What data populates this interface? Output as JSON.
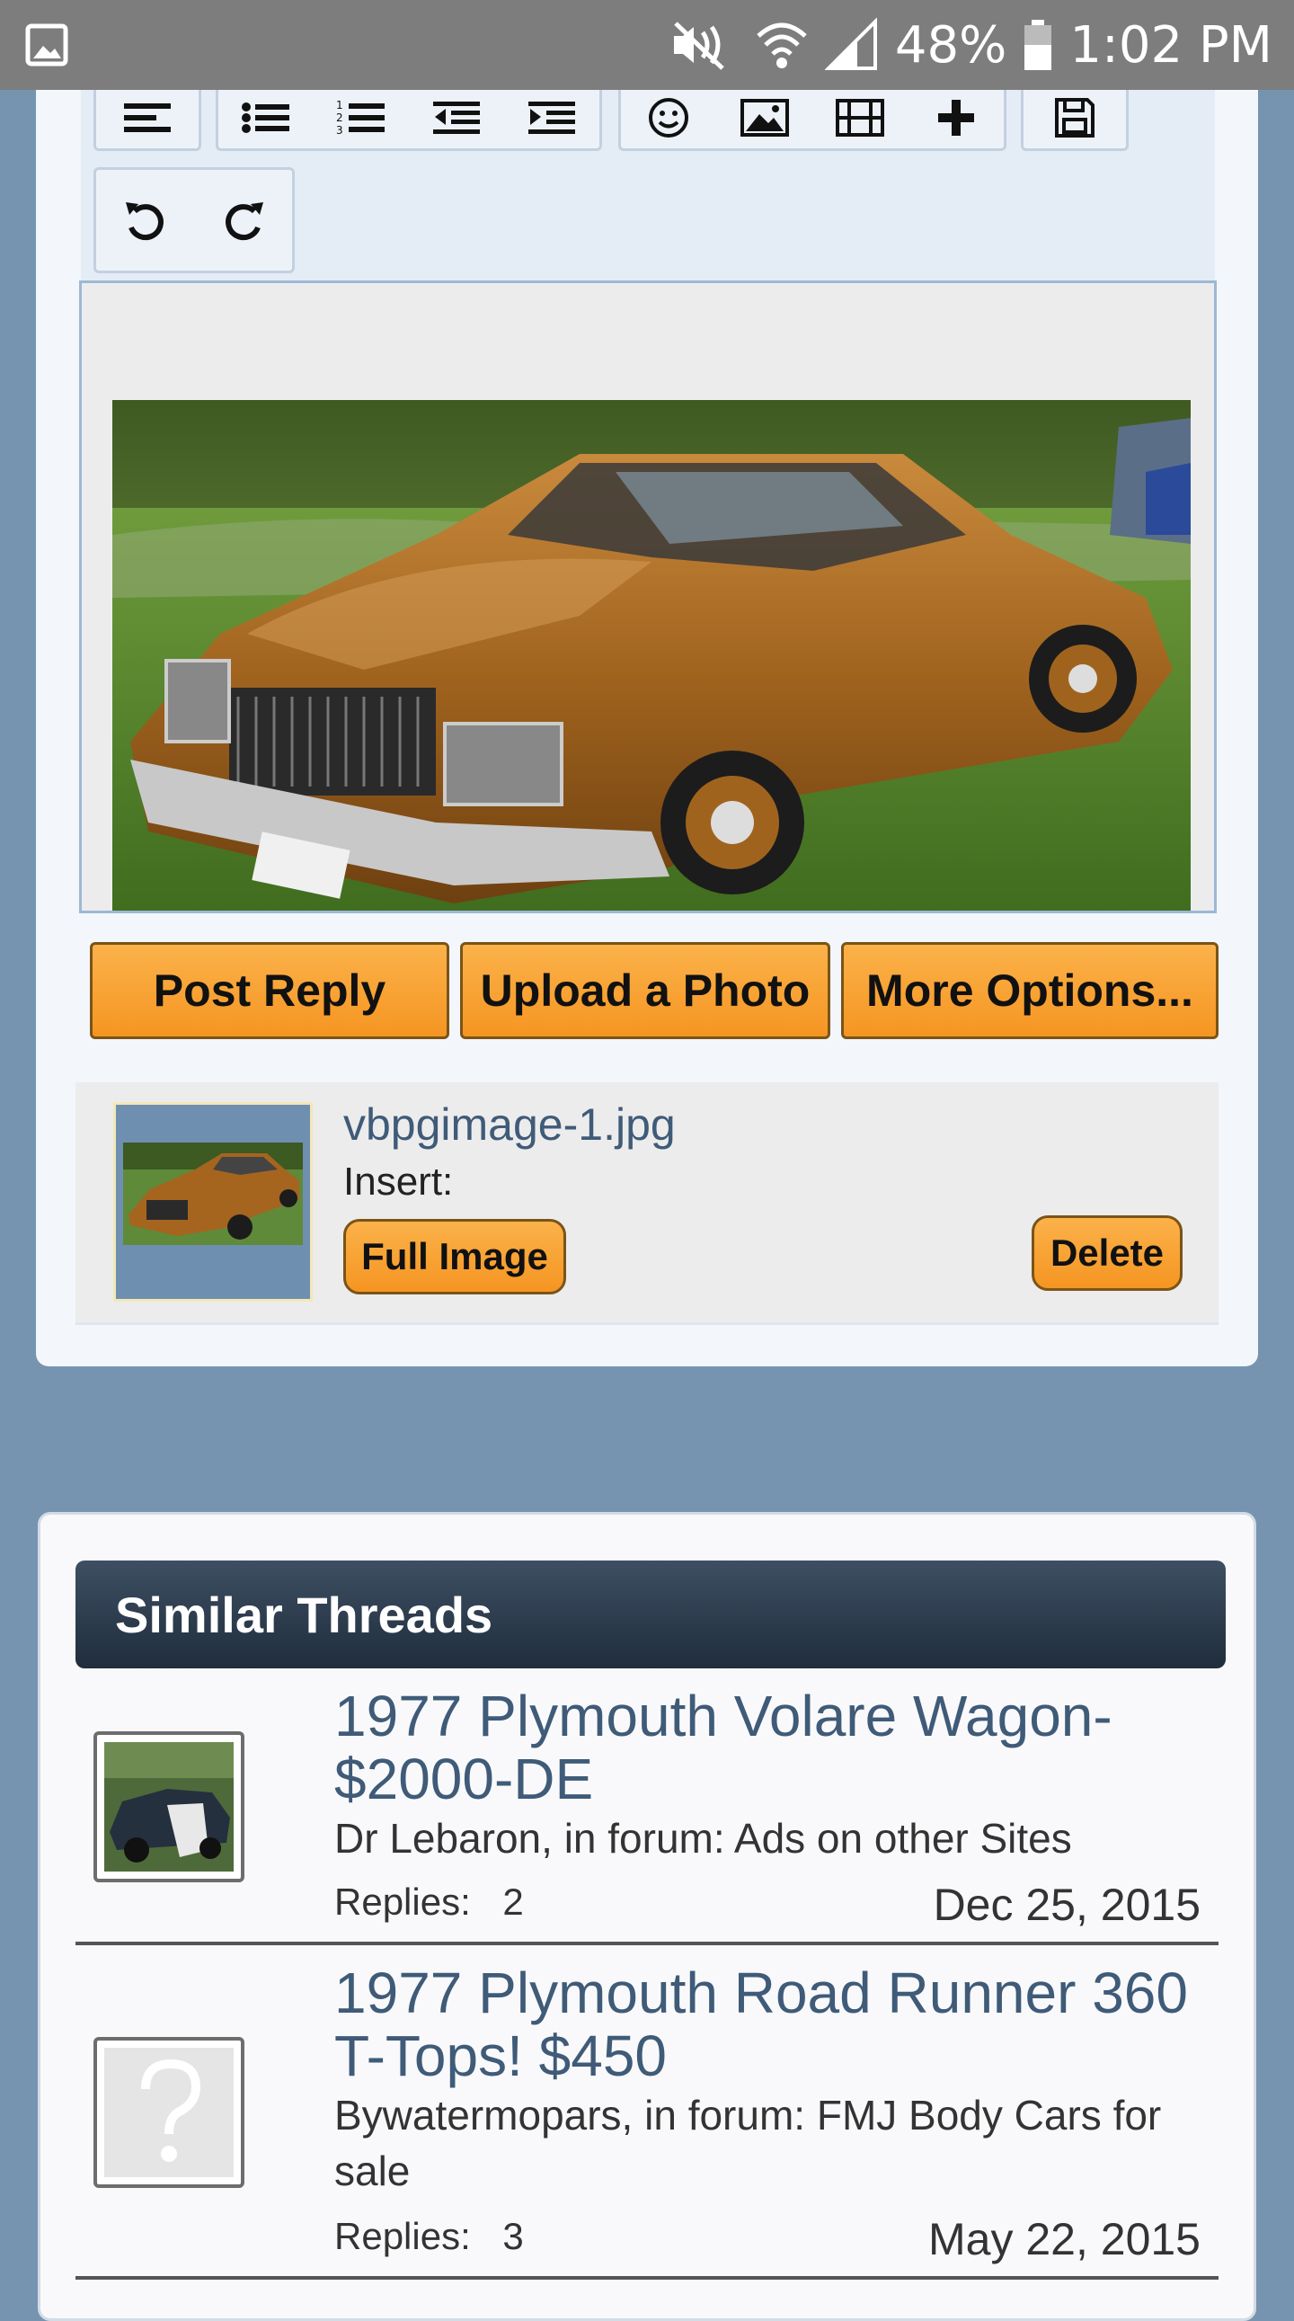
{
  "status_bar": {
    "battery_percent": "48%",
    "time": "1:02 PM",
    "icons": [
      "gallery-icon",
      "mute-icon",
      "wifi-icon",
      "signal-icon",
      "battery-icon"
    ]
  },
  "editor": {
    "toolbar_icons": [
      "align-left-icon",
      "bulleted-list-icon",
      "numbered-list-icon",
      "outdent-icon",
      "indent-icon",
      "smiley-icon",
      "image-icon",
      "video-icon",
      "plus-icon",
      "save-icon",
      "undo-icon",
      "redo-icon"
    ],
    "buttons": {
      "post_reply": "Post Reply",
      "upload_photo": "Upload a Photo",
      "more_options": "More Options..."
    },
    "attachment": {
      "filename": "vbpgimage-1.jpg",
      "insert_label": "Insert:",
      "full_image": "Full Image",
      "delete": "Delete"
    }
  },
  "similar_threads": {
    "header": "Similar Threads",
    "replies_label": "Replies:",
    "items": [
      {
        "title": "1977 Plymouth Volare Wagon- $2000-DE",
        "meta": "Dr Lebaron, in forum: Ads on other Sites",
        "replies": "2",
        "date": "Dec 25, 2015"
      },
      {
        "title": "1977 Plymouth Road Runner 360 T-Tops! $450",
        "meta": "Bywatermopars, in forum: FMJ Body Cars for sale",
        "replies": "3",
        "date": "May 22, 2015"
      }
    ]
  },
  "colors": {
    "page_background": "#7694b0",
    "button_orange": "#f7a233",
    "thread_link": "#3f5b78",
    "header_dark": "#2a3a4c"
  }
}
